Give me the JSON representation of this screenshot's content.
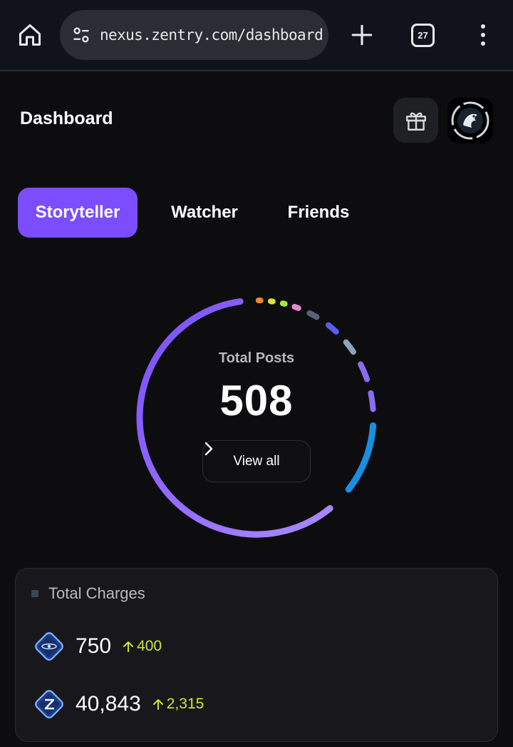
{
  "browser": {
    "url": "nexus.zentry.com/dashboard",
    "tab_count": "27",
    "icons": [
      "home-icon",
      "site-settings-icon",
      "new-tab-icon",
      "tab-switcher-icon",
      "overflow-menu-icon"
    ]
  },
  "header": {
    "title": "Dashboard",
    "icons": [
      "gift-icon",
      "dragon-avatar"
    ]
  },
  "tabs": [
    {
      "label": "Storyteller",
      "active": true
    },
    {
      "label": "Watcher",
      "active": false
    },
    {
      "label": "Friends",
      "active": false
    }
  ],
  "posts": {
    "label": "Total Posts",
    "value": "508",
    "view_all": "View all"
  },
  "charges": {
    "title": "Total Charges",
    "items": [
      {
        "value": "750",
        "delta": "400",
        "icon": "orb-charge-icon"
      },
      {
        "value": "40,843",
        "delta": "2,315",
        "icon": "z-charge-icon"
      }
    ]
  },
  "colors": {
    "accent": "#7b4dff",
    "delta_positive": "#c8e63a",
    "ring_gradient_start": "#7b4dff",
    "ring_gradient_end": "#a98bff",
    "ring_blue": "#1a8fe0",
    "small_segments": [
      "#f08a2c",
      "#d6e63a",
      "#a8e63a",
      "#e28ac8",
      "#5b5f7a",
      "#5a5cf0",
      "#8aa4b8",
      "#8a6cf0"
    ]
  }
}
